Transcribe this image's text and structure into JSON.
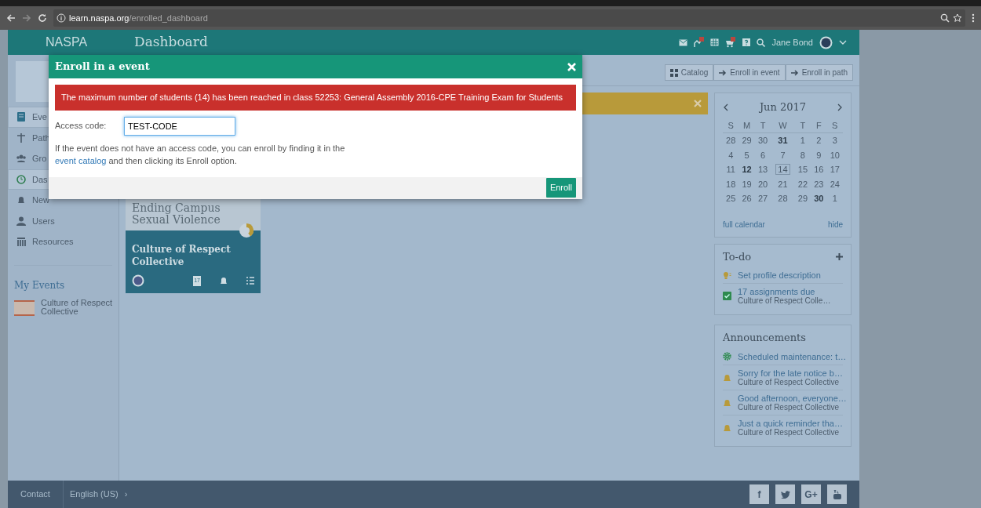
{
  "browser": {
    "url_host": "learn.naspa.org",
    "url_path": "/enrolled_dashboard"
  },
  "header": {
    "brand": "NASPA",
    "title": "Dashboard",
    "user": "Jane Bond"
  },
  "sidebar": {
    "items": [
      {
        "label": "Eve",
        "kind": "book",
        "selected": true
      },
      {
        "label": "Path",
        "kind": "signpost",
        "selected": false
      },
      {
        "label": "Gro",
        "kind": "group",
        "selected": false
      },
      {
        "label": "Das",
        "kind": "dashboard",
        "selected": true
      },
      {
        "label": "New",
        "kind": "bell",
        "selected": false
      },
      {
        "label": "Users",
        "kind": "user",
        "selected": false
      },
      {
        "label": "Resources",
        "kind": "columns",
        "selected": false
      }
    ],
    "my_events_title": "My Events",
    "my_events": [
      {
        "label": "Culture of Respect Collective"
      }
    ]
  },
  "toolbar": [
    {
      "label": "Catalog",
      "kind": "grid"
    },
    {
      "label": "Enroll in event",
      "kind": "arrow"
    },
    {
      "label": "Enroll in path",
      "kind": "arrow"
    }
  ],
  "event_card": {
    "image_title": "Ending Campus Sexual Violence",
    "title": "Culture of Respect Collective",
    "calendar_day": "17"
  },
  "calendar": {
    "month": "Jun 2017",
    "weekdays": [
      "S",
      "M",
      "T",
      "W",
      "T",
      "F",
      "S"
    ],
    "weeks": [
      [
        {
          "d": "28",
          "bold": false,
          "today": false
        },
        {
          "d": "29",
          "bold": false,
          "today": false
        },
        {
          "d": "30",
          "bold": false,
          "today": false
        },
        {
          "d": "31",
          "bold": true,
          "today": false
        },
        {
          "d": "1",
          "bold": false,
          "today": false
        },
        {
          "d": "2",
          "bold": false,
          "today": false
        },
        {
          "d": "3",
          "bold": false,
          "today": false
        }
      ],
      [
        {
          "d": "4",
          "bold": false,
          "today": false
        },
        {
          "d": "5",
          "bold": false,
          "today": false
        },
        {
          "d": "6",
          "bold": false,
          "today": false
        },
        {
          "d": "7",
          "bold": false,
          "today": false
        },
        {
          "d": "8",
          "bold": false,
          "today": false
        },
        {
          "d": "9",
          "bold": false,
          "today": false
        },
        {
          "d": "10",
          "bold": false,
          "today": false
        }
      ],
      [
        {
          "d": "11",
          "bold": false,
          "today": false
        },
        {
          "d": "12",
          "bold": true,
          "today": false
        },
        {
          "d": "13",
          "bold": false,
          "today": false
        },
        {
          "d": "14",
          "bold": false,
          "today": true
        },
        {
          "d": "15",
          "bold": false,
          "today": false
        },
        {
          "d": "16",
          "bold": false,
          "today": false
        },
        {
          "d": "17",
          "bold": false,
          "today": false
        }
      ],
      [
        {
          "d": "18",
          "bold": false,
          "today": false
        },
        {
          "d": "19",
          "bold": false,
          "today": false
        },
        {
          "d": "20",
          "bold": false,
          "today": false
        },
        {
          "d": "21",
          "bold": false,
          "today": false
        },
        {
          "d": "22",
          "bold": false,
          "today": false
        },
        {
          "d": "23",
          "bold": false,
          "today": false
        },
        {
          "d": "24",
          "bold": false,
          "today": false
        }
      ],
      [
        {
          "d": "25",
          "bold": false,
          "today": false
        },
        {
          "d": "26",
          "bold": false,
          "today": false
        },
        {
          "d": "27",
          "bold": false,
          "today": false
        },
        {
          "d": "28",
          "bold": false,
          "today": false
        },
        {
          "d": "29",
          "bold": false,
          "today": false
        },
        {
          "d": "30",
          "bold": true,
          "today": false
        },
        {
          "d": "1",
          "bold": false,
          "today": false
        }
      ]
    ],
    "full_calendar": "full calendar",
    "hide": "hide"
  },
  "todo": {
    "title": "To-do",
    "items": [
      {
        "kind": "tip",
        "title": "Set profile description"
      },
      {
        "kind": "assignment",
        "title": "17 assignments due",
        "subtitle": "Culture of Respect Colle…"
      }
    ]
  },
  "announcements": {
    "title": "Announcements",
    "items": [
      {
        "kind": "maintenance",
        "title": "Scheduled maintenance: t…"
      },
      {
        "kind": "news",
        "title": "Sorry for the late notice b…",
        "subtitle": "Culture of Respect Collective"
      },
      {
        "kind": "news",
        "title": "Good afternoon, everyone…",
        "subtitle": "Culture of Respect Collective"
      },
      {
        "kind": "news",
        "title": "Just a quick reminder tha…",
        "subtitle": "Culture of Respect Collective"
      }
    ]
  },
  "modal": {
    "title": "Enroll in a event",
    "error": "The maximum number of students (14) has been reached in class 52253: General Assembly 2016-CPE Training Exam for Students",
    "field_label": "Access code:",
    "value": "TEST-CODE",
    "help_before": "If the event does not have an access code, you can enroll by finding it in the",
    "link": "event catalog",
    "help_after": "and then clicking its Enroll option.",
    "button": "Enroll"
  },
  "footer": {
    "contact": "Contact",
    "language": "English (US)",
    "chevron": "›",
    "social": [
      {
        "kind": "facebook",
        "label": "f"
      },
      {
        "kind": "twitter"
      },
      {
        "kind": "googleplus",
        "label": "G+"
      },
      {
        "kind": "youtube"
      }
    ]
  }
}
